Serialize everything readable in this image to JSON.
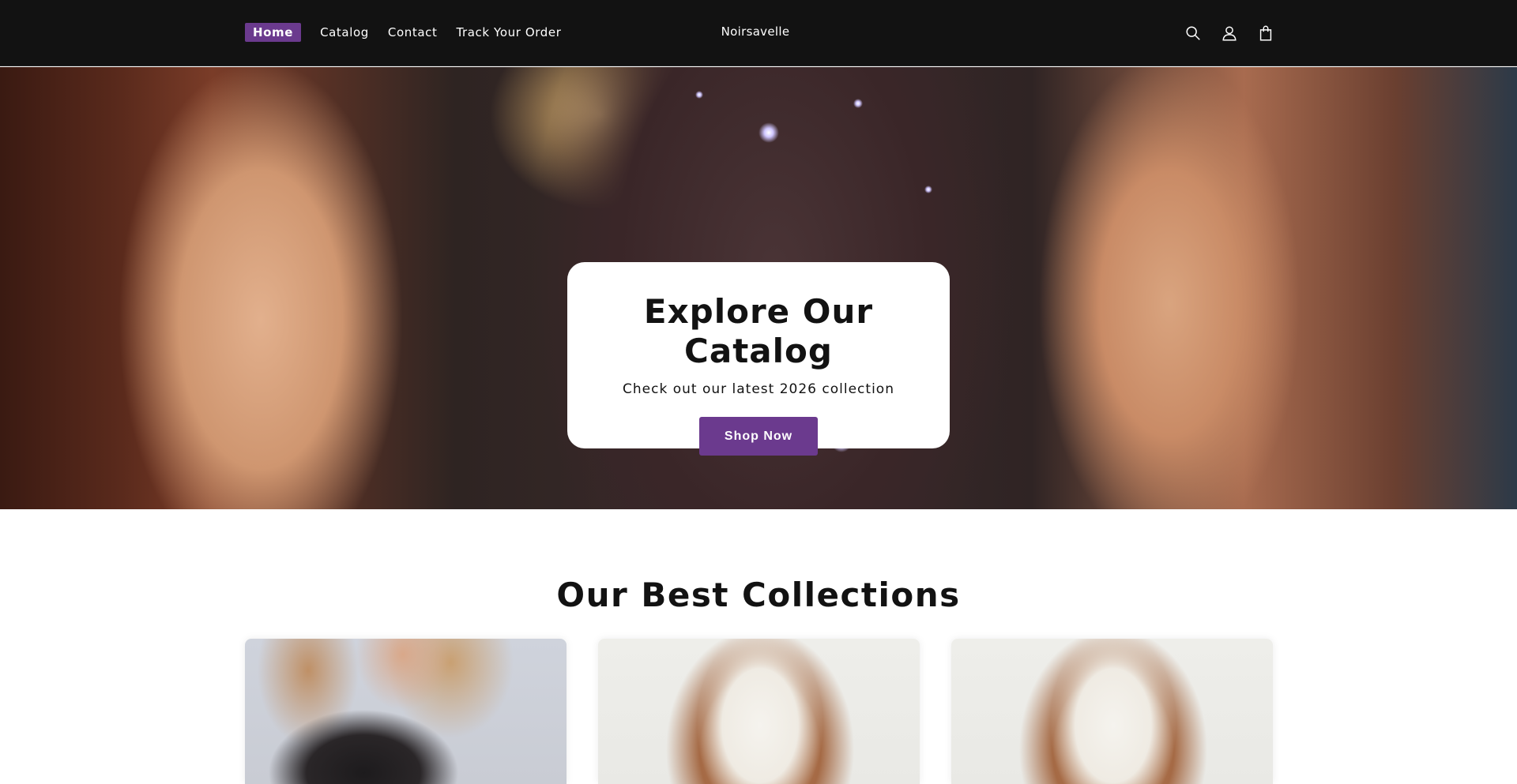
{
  "header": {
    "nav": [
      {
        "label": "Home",
        "active": true
      },
      {
        "label": "Catalog",
        "active": false
      },
      {
        "label": "Contact",
        "active": false
      },
      {
        "label": "Track Your Order",
        "active": false
      }
    ],
    "brand": "Noirsavelle",
    "icons": [
      "search-icon",
      "account-icon",
      "cart-icon"
    ]
  },
  "hero": {
    "title": "Explore Our Catalog",
    "subtitle": "Check out our latest 2026 collection",
    "button_label": "Shop Now"
  },
  "collections": {
    "title": "Our Best Collections",
    "cards": [
      {
        "image": "black-lace-strapless-dress"
      },
      {
        "image": "white-v-neck-dress"
      },
      {
        "image": "white-v-neck-dress"
      }
    ]
  },
  "colors": {
    "header_bg": "#121212",
    "accent": "#6b3a8e",
    "text": "#121212",
    "background": "#ffffff"
  }
}
